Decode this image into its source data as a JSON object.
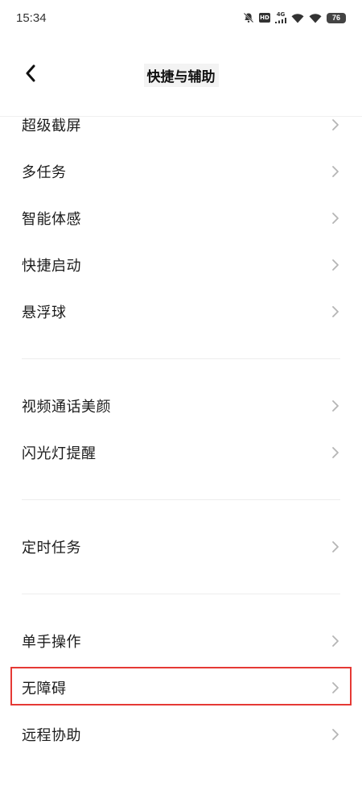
{
  "status_bar": {
    "time": "15:34",
    "network_label": "4G",
    "hd_label": "HD",
    "battery": "76"
  },
  "header": {
    "title": "快捷与辅助"
  },
  "groups": [
    {
      "items": [
        {
          "label": "超级截屏"
        },
        {
          "label": "多任务"
        },
        {
          "label": "智能体感"
        },
        {
          "label": "快捷启动"
        },
        {
          "label": "悬浮球"
        }
      ]
    },
    {
      "items": [
        {
          "label": "视频通话美颜"
        },
        {
          "label": "闪光灯提醒"
        }
      ]
    },
    {
      "items": [
        {
          "label": "定时任务"
        }
      ]
    },
    {
      "items": [
        {
          "label": "单手操作"
        },
        {
          "label": "无障碍"
        },
        {
          "label": "远程协助"
        }
      ]
    }
  ],
  "colors": {
    "highlight": "#e53935",
    "chevron": "#b5b5b5"
  }
}
